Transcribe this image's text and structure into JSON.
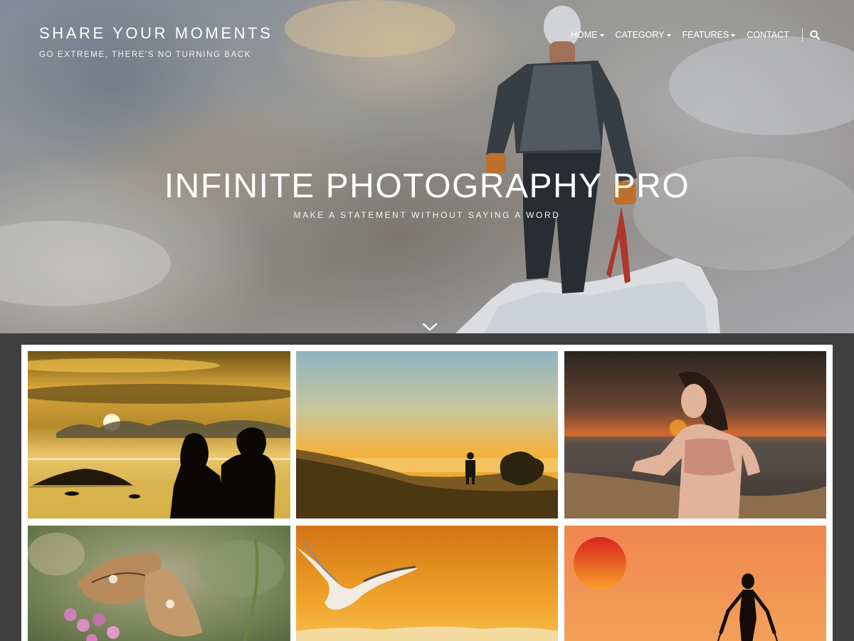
{
  "site": {
    "title": "SHARE YOUR MOMENTS",
    "tagline": "GO EXTREME, THERE'S NO TURNING BACK"
  },
  "nav": {
    "items": [
      {
        "label": "HOME",
        "has_dropdown": true
      },
      {
        "label": "CATEGORY",
        "has_dropdown": true
      },
      {
        "label": "FEATURES",
        "has_dropdown": true
      },
      {
        "label": "CONTACT",
        "has_dropdown": false
      }
    ],
    "search_icon": "search-icon"
  },
  "hero": {
    "title": "INFINITE PHOTOGRAPHY PRO",
    "subtitle": "MAKE A STATEMENT WITHOUT SAYING A WORD",
    "scroll_icon": "chevron-down-icon"
  },
  "gallery": {
    "photos": [
      {
        "subject": "couple silhouette at sunset over lake"
      },
      {
        "subject": "hiker on grassy hill at sunrise"
      },
      {
        "subject": "woman posing on beach at sunset"
      },
      {
        "subject": "butterfly on pink flowers"
      },
      {
        "subject": "seagull flying in orange sky"
      },
      {
        "subject": "silhouette jumping rope at sunset"
      }
    ]
  },
  "colors": {
    "page_background": "#3f3f3f",
    "gallery_frame": "#ffffff",
    "text": "#ffffff"
  }
}
